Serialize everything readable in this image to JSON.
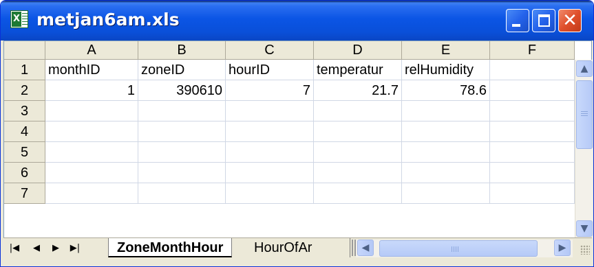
{
  "window": {
    "title": "metjan6am.xls",
    "app_icon": "excel-icon",
    "buttons": {
      "minimize": "minimize-icon",
      "maximize": "maximize-icon",
      "close": "close-icon"
    }
  },
  "sheet": {
    "columns": [
      "A",
      "B",
      "C",
      "D",
      "E",
      "F"
    ],
    "rows": [
      "1",
      "2",
      "3",
      "4",
      "5",
      "6",
      "7"
    ],
    "header_row": [
      "monthID",
      "zoneID",
      "hourID",
      "temperatur",
      "relHumidity"
    ],
    "data_row": [
      "1",
      "390610",
      "7",
      "21.7",
      "78.6"
    ]
  },
  "tabs": {
    "active": "ZoneMonthHour",
    "inactive": "HourOfAr",
    "nav": [
      "first-sheet-icon",
      "prev-sheet-icon",
      "next-sheet-icon",
      "last-sheet-icon"
    ]
  },
  "colors": {
    "titlebar": "#0a4fd8",
    "chrome": "#ece9d8",
    "gridline": "#d0d7e5",
    "close_button": "#e0502c"
  }
}
